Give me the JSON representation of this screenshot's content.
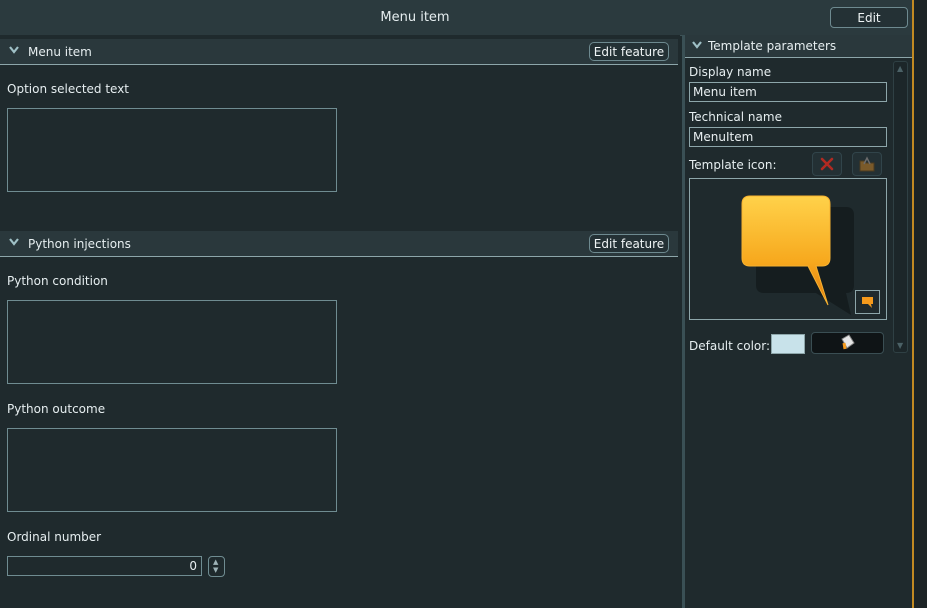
{
  "header": {
    "title": "Menu item",
    "edit_label": "Edit"
  },
  "sections": [
    {
      "title": "Menu item",
      "button_label": "Edit feature",
      "fields": [
        {
          "label": "Option selected text",
          "value": ""
        }
      ]
    },
    {
      "title": "Python injections",
      "button_label": "Edit feature",
      "fields": [
        {
          "label": "Python condition",
          "value": ""
        },
        {
          "label": "Python outcome",
          "value": ""
        },
        {
          "label": "Ordinal number",
          "value": "0"
        }
      ]
    }
  ],
  "template_parameters": {
    "title": "Template parameters",
    "display_name_label": "Display name",
    "display_name_value": "Menu item",
    "technical_name_label": "Technical name",
    "technical_name_value": "MenuItem",
    "template_icon_label": "Template icon:",
    "icon_name": "speech-bubble-icon",
    "default_color_label": "Default color:",
    "default_color": "#c8e2ea"
  },
  "colors": {
    "accent": "#c28a22",
    "icon_orange": "#f59a1c"
  }
}
